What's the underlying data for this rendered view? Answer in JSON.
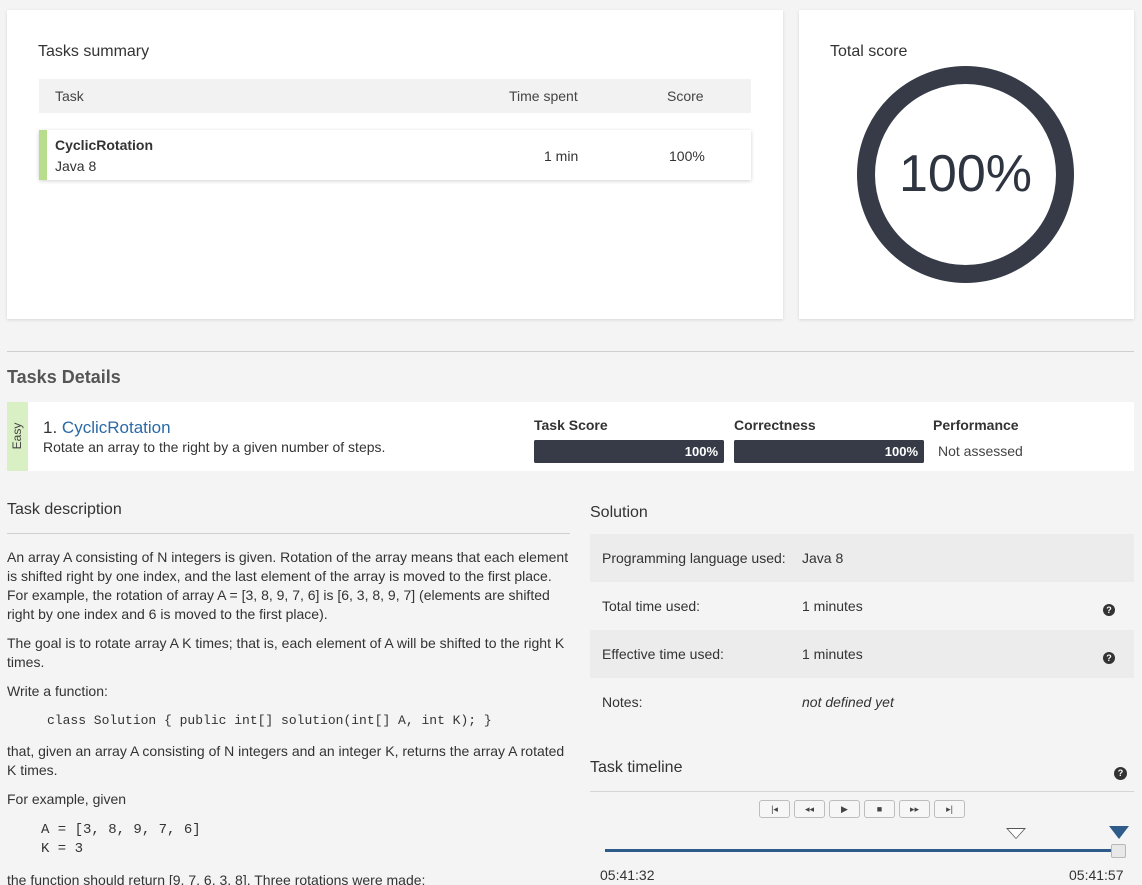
{
  "summary": {
    "title": "Tasks summary",
    "headers": {
      "task": "Task",
      "time": "Time spent",
      "score": "Score"
    },
    "rows": [
      {
        "name": "CyclicRotation",
        "lang": "Java 8",
        "time": "1 min",
        "score": "100%"
      }
    ]
  },
  "total": {
    "title": "Total score",
    "value": "100%"
  },
  "details": {
    "title": "Tasks Details",
    "difficulty": "Easy",
    "task_number": "1.",
    "task_name": "CyclicRotation",
    "task_desc": "Rotate an array to the right by a given number of steps.",
    "task_score_label": "Task Score",
    "task_score": "100%",
    "task_score_fraction": 1.0,
    "correctness_label": "Correctness",
    "correctness": "100%",
    "correctness_fraction": 1.0,
    "performance_label": "Performance",
    "performance": "Not assessed"
  },
  "description": {
    "title": "Task description",
    "p1": "An array A consisting of N integers is given. Rotation of the array means that each element is shifted right by one index, and the last element of the array is moved to the first place. For example, the rotation of array A = [3, 8, 9, 7, 6] is [6, 3, 8, 9, 7] (elements are shifted right by one index and 6 is moved to the first place).",
    "p2": "The goal is to rotate array A K times; that is, each element of A will be shifted to the right K times.",
    "p3": "Write a function:",
    "code1": "class Solution { public int[] solution(int[] A, int K); }",
    "p4": "that, given an array A consisting of N integers and an integer K, returns the array A rotated K times.",
    "p5": "For example, given",
    "code2": "A = [3, 8, 9, 7, 6]\nK = 3",
    "p6": "the function should return [9, 7, 6, 3, 8]. Three rotations were made:"
  },
  "solution": {
    "title": "Solution",
    "rows": [
      {
        "k": "Programming language used:",
        "v": "Java 8"
      },
      {
        "k": "Total time used:",
        "v": "1 minutes"
      },
      {
        "k": "Effective time used:",
        "v": "1 minutes"
      },
      {
        "k": "Notes:",
        "v": "not defined yet"
      }
    ]
  },
  "timeline": {
    "title": "Task timeline",
    "controls": [
      "|◂",
      "◂◂",
      "▶",
      "■",
      "▸▸",
      "▸|"
    ],
    "start": "05:41:32",
    "end": "05:41:57"
  },
  "icons": {
    "help": "?"
  }
}
